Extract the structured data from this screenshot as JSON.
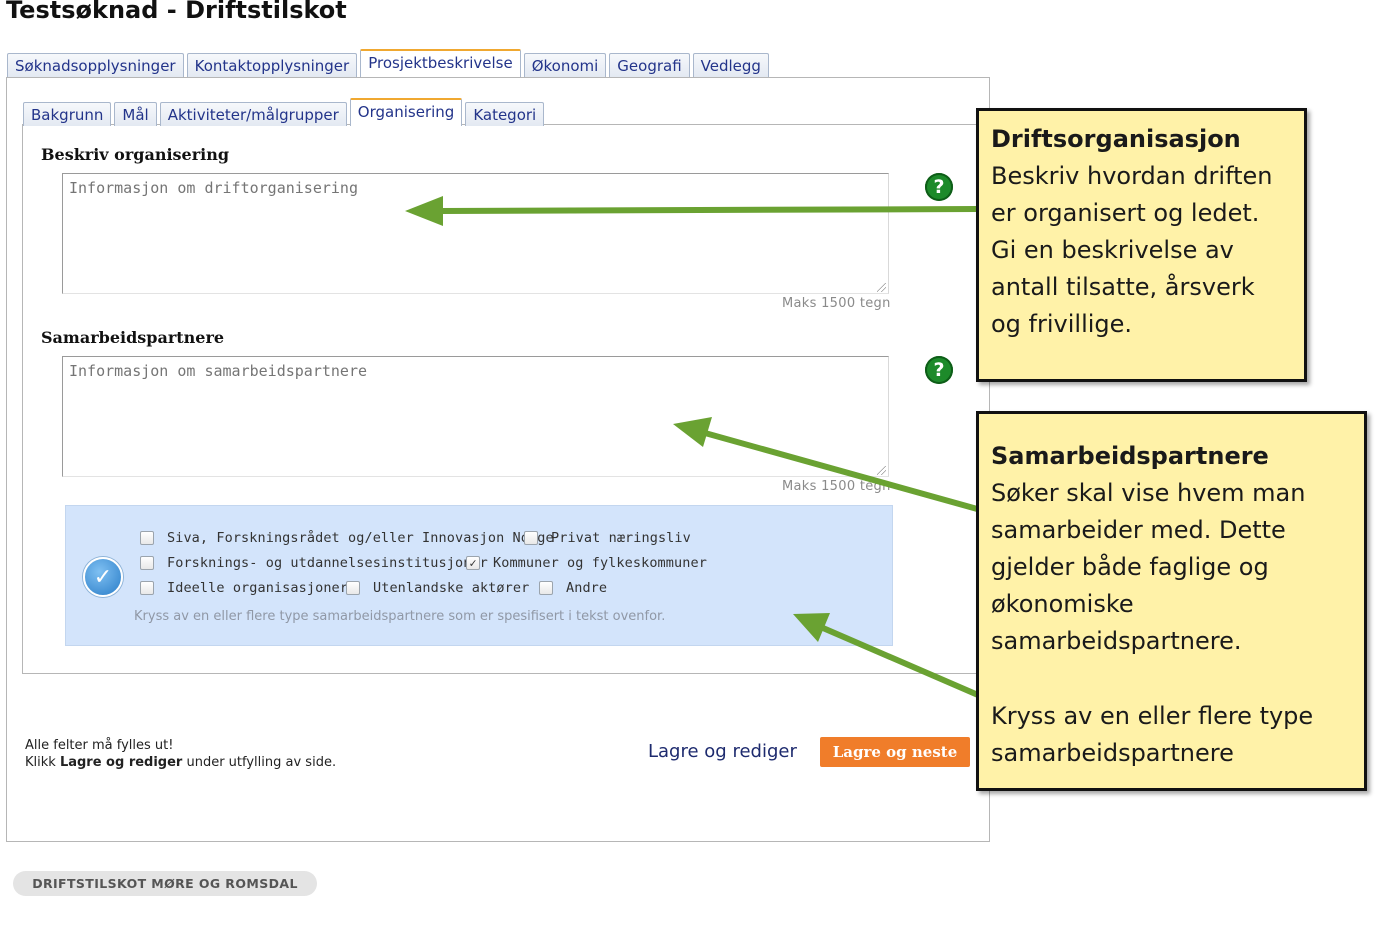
{
  "page": {
    "title": "Testsøknad - Driftstilskot"
  },
  "main_tabs": [
    {
      "label": "Søknadsopplysninger",
      "active": false
    },
    {
      "label": "Kontaktopplysninger",
      "active": false
    },
    {
      "label": "Prosjektbeskrivelse",
      "active": true
    },
    {
      "label": "Økonomi",
      "active": false
    },
    {
      "label": "Geografi",
      "active": false
    },
    {
      "label": "Vedlegg",
      "active": false
    }
  ],
  "sub_tabs": [
    {
      "label": "Bakgrunn",
      "active": false
    },
    {
      "label": "Mål",
      "active": false
    },
    {
      "label": "Aktiviteter/målgrupper",
      "active": false
    },
    {
      "label": "Organisering",
      "active": true
    },
    {
      "label": "Kategori",
      "active": false
    }
  ],
  "organisation": {
    "label": "Beskriv organisering",
    "placeholder": "Informasjon om driftorganisering",
    "max_text": "Maks 1500 tegn"
  },
  "partners": {
    "label": "Samarbeidspartnere",
    "placeholder": "Informasjon om samarbeidspartnere",
    "max_text": "Maks 1500 tegn"
  },
  "partner_types": {
    "options": [
      {
        "label": "Siva, Forskningsrådet og/eller Innovasjon Norge",
        "checked": false
      },
      {
        "label": "Privat næringsliv",
        "checked": false
      },
      {
        "label": "Forsknings- og utdannelsesinstitusjoner",
        "checked": false
      },
      {
        "label": "Kommuner og fylkeskommuner",
        "checked": true
      },
      {
        "label": "Ideelle organisasjoner",
        "checked": false
      },
      {
        "label": "Utenlandske aktører",
        "checked": false
      },
      {
        "label": "Andre",
        "checked": false
      }
    ],
    "hint": "Kryss av en eller flere type samarbeidspartnere som er spesifisert i tekst ovenfor."
  },
  "footer": {
    "required_line1": "Alle felter må fylles ut!",
    "required_line2_prefix": "Klikk ",
    "required_line2_bold": "Lagre og rediger",
    "required_line2_suffix": " under utfylling av side.",
    "save_edit": "Lagre og rediger",
    "save_next": "Lagre og neste",
    "tag": "DRIFTSTILSKOT MØRE OG ROMSDAL"
  },
  "callouts": {
    "organisation": {
      "title": "Driftsorganisasjon",
      "body": "Beskriv hvordan driften er organisert og ledet. Gi en beskrivelse av antall tilsatte, årsverk og frivillige."
    },
    "partners": {
      "title": "Samarbeidspartnere",
      "body": "Søker skal vise hvem man samarbeider med. Dette gjelder både faglige og økonomiske samarbeidspartnere.",
      "extra": "Kryss av en eller flere type samarbeidspartnere"
    }
  },
  "colors": {
    "accent_orange": "#f07d2a",
    "help_green": "#1d8a2a",
    "arrow_green": "#6aa232",
    "callout_yellow": "#fff2a8",
    "partner_bg": "#d3e4fb"
  },
  "icons": {
    "help": "question-circle-icon",
    "partner_badge": "check-circle-icon",
    "checked_glyph": "✓"
  }
}
